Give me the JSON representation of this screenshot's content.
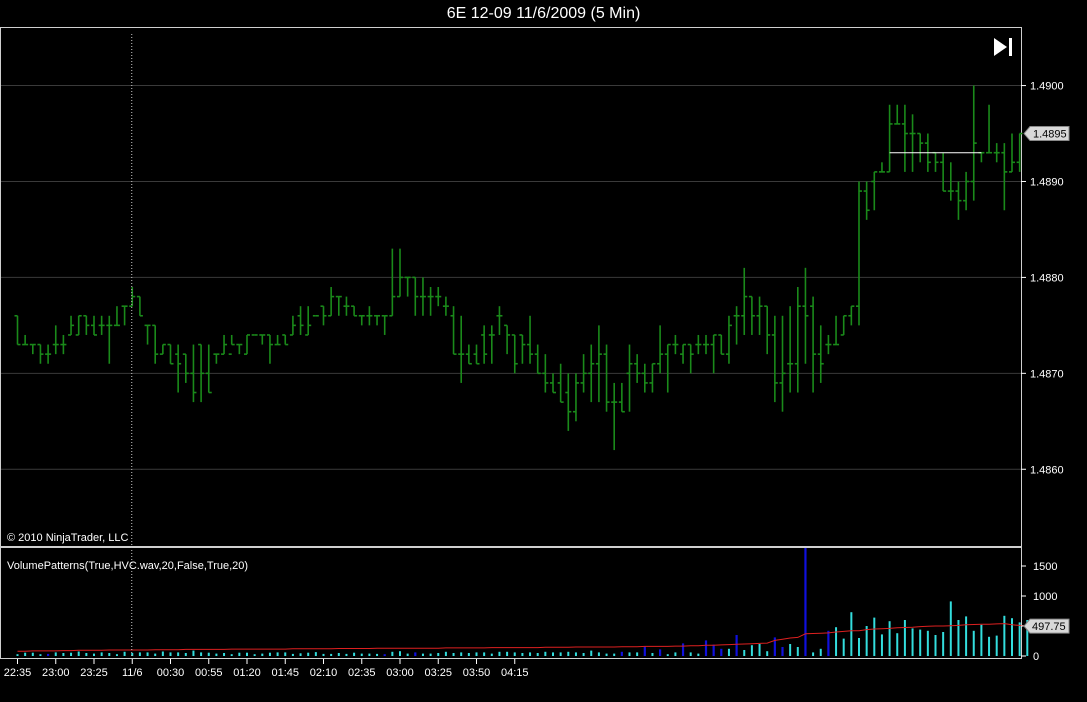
{
  "window": {
    "title": "6E 12-09  11/6/2009 (5 Min)"
  },
  "copyright": "© 2010 NinjaTrader, LLC",
  "indicator_label": "VolumePatterns(True,HVC.wav,20,False,True,20)",
  "icons": {
    "go_to_end": "skip-to-end-icon"
  },
  "colors": {
    "bars": "#1a8a1a",
    "volume_normal": "#33dddd",
    "volume_high": "#1010dd",
    "volume_ma": "#dd2020",
    "grid": "#3a3a3a",
    "last_price_line": "#ffffff"
  },
  "chart_data": [
    {
      "type": "ohlc",
      "price_ylim": [
        1.4852,
        1.4906
      ],
      "y_ticks": [
        "1.4860",
        "1.4870",
        "1.4880",
        "1.4890",
        "1.4900"
      ],
      "last_price_marker": "1.4895",
      "x_tick_labels": [
        "22:35",
        "23:00",
        "23:25",
        "11/6",
        "00:30",
        "00:55",
        "01:20",
        "01:45",
        "02:10",
        "02:35",
        "03:00",
        "03:25",
        "03:50",
        "04:15"
      ],
      "session_break_label": "11/6",
      "bars": [
        [
          1.4876,
          1.4876,
          1.4873,
          1.4873
        ],
        [
          1.4873,
          1.4874,
          1.4873,
          1.4873
        ],
        [
          1.4873,
          1.4873,
          1.4872,
          1.4873
        ],
        [
          1.4873,
          1.4873,
          1.4871,
          1.4872
        ],
        [
          1.4872,
          1.4873,
          1.4871,
          1.4872
        ],
        [
          1.4873,
          1.4875,
          1.4872,
          1.4873
        ],
        [
          1.4873,
          1.4874,
          1.4872,
          1.4873
        ],
        [
          1.4874,
          1.4876,
          1.4874,
          1.4875
        ],
        [
          1.4874,
          1.4876,
          1.4874,
          1.4876
        ],
        [
          1.4876,
          1.4876,
          1.4874,
          1.4875
        ],
        [
          1.4875,
          1.4876,
          1.4874,
          1.4874
        ],
        [
          1.4875,
          1.4876,
          1.4874,
          1.4875
        ],
        [
          1.4875,
          1.4876,
          1.4871,
          1.4875
        ],
        [
          1.4875,
          1.4877,
          1.4875,
          1.4875
        ],
        [
          1.4877,
          1.4877,
          1.4875,
          1.4877
        ],
        [
          1.4877,
          1.4879,
          1.4877,
          1.4878
        ],
        [
          1.4878,
          1.4878,
          1.4876,
          1.4876
        ],
        [
          1.4875,
          1.4875,
          1.4873,
          1.4875
        ],
        [
          1.4875,
          1.4875,
          1.4871,
          1.4872
        ],
        [
          1.4872,
          1.4873,
          1.4872,
          1.4873
        ],
        [
          1.4873,
          1.4873,
          1.4871,
          1.4871
        ],
        [
          1.4872,
          1.4873,
          1.4868,
          1.4871
        ],
        [
          1.4872,
          1.4872,
          1.4869,
          1.487
        ],
        [
          1.487,
          1.4873,
          1.4867,
          1.4868
        ],
        [
          1.4873,
          1.4873,
          1.4867,
          1.487
        ],
        [
          1.487,
          1.4873,
          1.4868,
          1.4868
        ],
        [
          1.4872,
          1.4872,
          1.4871,
          1.4872
        ],
        [
          1.4872,
          1.4874,
          1.4872,
          1.4873
        ],
        [
          1.4872,
          1.4874,
          1.4873,
          1.4873
        ],
        [
          1.4873,
          1.4873,
          1.4872,
          1.4873
        ],
        [
          1.4872,
          1.4874,
          1.4872,
          1.4874
        ],
        [
          1.4874,
          1.4874,
          1.4874,
          1.4874
        ],
        [
          1.4874,
          1.4874,
          1.4873,
          1.4874
        ],
        [
          1.4874,
          1.4874,
          1.4871,
          1.4873
        ],
        [
          1.4873,
          1.4874,
          1.4873,
          1.4873
        ],
        [
          1.4874,
          1.4874,
          1.4873,
          1.4873
        ],
        [
          1.4874,
          1.4876,
          1.4874,
          1.4875
        ],
        [
          1.4876,
          1.4877,
          1.4874,
          1.4875
        ],
        [
          1.4874,
          1.4877,
          1.4874,
          1.4875
        ],
        [
          1.4876,
          1.4876,
          1.4876,
          1.4876
        ],
        [
          1.4877,
          1.4877,
          1.4875,
          1.4876
        ],
        [
          1.4876,
          1.4879,
          1.4876,
          1.4878
        ],
        [
          1.4878,
          1.4878,
          1.4876,
          1.4878
        ],
        [
          1.4877,
          1.4878,
          1.4876,
          1.4877
        ],
        [
          1.4877,
          1.4877,
          1.4876,
          1.4876
        ],
        [
          1.4876,
          1.4876,
          1.4875,
          1.4876
        ],
        [
          1.4876,
          1.4877,
          1.4875,
          1.4876
        ],
        [
          1.4876,
          1.4876,
          1.4875,
          1.4876
        ],
        [
          1.4876,
          1.4876,
          1.4874,
          1.4876
        ],
        [
          1.4876,
          1.4883,
          1.4876,
          1.4878
        ],
        [
          1.4878,
          1.4883,
          1.4878,
          1.488
        ],
        [
          1.488,
          1.488,
          1.4878,
          1.488
        ],
        [
          1.488,
          1.488,
          1.4876,
          1.4878
        ],
        [
          1.4878,
          1.488,
          1.4876,
          1.4878
        ],
        [
          1.4878,
          1.4879,
          1.4876,
          1.4878
        ],
        [
          1.4878,
          1.4879,
          1.4877,
          1.4878
        ],
        [
          1.4877,
          1.4878,
          1.4876,
          1.4877
        ],
        [
          1.4876,
          1.4877,
          1.4872,
          1.4872
        ],
        [
          1.4872,
          1.4876,
          1.4869,
          1.4872
        ],
        [
          1.4872,
          1.4873,
          1.4871,
          1.4871
        ],
        [
          1.4872,
          1.4873,
          1.4871,
          1.4871
        ],
        [
          1.4874,
          1.4875,
          1.4871,
          1.4872
        ],
        [
          1.4874,
          1.4875,
          1.4871,
          1.4874
        ],
        [
          1.4876,
          1.4877,
          1.4874,
          1.4876
        ],
        [
          1.4875,
          1.4875,
          1.4872,
          1.4874
        ],
        [
          1.4874,
          1.4874,
          1.487,
          1.4871
        ],
        [
          1.4874,
          1.4874,
          1.4871,
          1.4873
        ],
        [
          1.4873,
          1.4876,
          1.4871,
          1.4872
        ],
        [
          1.4872,
          1.4873,
          1.487,
          1.487
        ],
        [
          1.487,
          1.4872,
          1.4868,
          1.4869
        ],
        [
          1.4869,
          1.487,
          1.4868,
          1.4868
        ],
        [
          1.4869,
          1.4871,
          1.4867,
          1.4867
        ],
        [
          1.4868,
          1.487,
          1.4864,
          1.4866
        ],
        [
          1.4866,
          1.487,
          1.4865,
          1.4869
        ],
        [
          1.4869,
          1.4872,
          1.4868,
          1.487
        ],
        [
          1.487,
          1.4873,
          1.4867,
          1.4871
        ],
        [
          1.4871,
          1.4875,
          1.4867,
          1.4872
        ],
        [
          1.4872,
          1.4873,
          1.4866,
          1.4867
        ],
        [
          1.4867,
          1.4869,
          1.4862,
          1.4867
        ],
        [
          1.4867,
          1.4869,
          1.4866,
          1.4866
        ],
        [
          1.487,
          1.4873,
          1.4866,
          1.4871
        ],
        [
          1.4871,
          1.4872,
          1.4869,
          1.487
        ],
        [
          1.487,
          1.4871,
          1.4868,
          1.4869
        ],
        [
          1.4869,
          1.4871,
          1.4868,
          1.4871
        ],
        [
          1.4871,
          1.4875,
          1.487,
          1.4872
        ],
        [
          1.4872,
          1.4873,
          1.4868,
          1.4873
        ],
        [
          1.4873,
          1.4874,
          1.4872,
          1.4873
        ],
        [
          1.4872,
          1.4873,
          1.4871,
          1.4873
        ],
        [
          1.4873,
          1.4873,
          1.487,
          1.4872
        ],
        [
          1.4873,
          1.4874,
          1.4872,
          1.4873
        ],
        [
          1.4873,
          1.4874,
          1.4872,
          1.4873
        ],
        [
          1.4873,
          1.4874,
          1.487,
          1.4874
        ],
        [
          1.4874,
          1.4874,
          1.4872,
          1.4872
        ],
        [
          1.4872,
          1.4876,
          1.4871,
          1.4875
        ],
        [
          1.4876,
          1.4877,
          1.4873,
          1.4876
        ],
        [
          1.4876,
          1.4881,
          1.4874,
          1.4878
        ],
        [
          1.4878,
          1.4878,
          1.4874,
          1.4876
        ],
        [
          1.4876,
          1.4878,
          1.4874,
          1.4877
        ],
        [
          1.4877,
          1.4877,
          1.4872,
          1.4874
        ],
        [
          1.4874,
          1.4876,
          1.4867,
          1.4869
        ],
        [
          1.4869,
          1.4876,
          1.4866,
          1.487
        ],
        [
          1.4871,
          1.4877,
          1.4868,
          1.4871
        ],
        [
          1.4871,
          1.4879,
          1.4868,
          1.4877
        ],
        [
          1.4877,
          1.4881,
          1.4871,
          1.4876
        ],
        [
          1.4877,
          1.4878,
          1.4868,
          1.4872
        ],
        [
          1.4872,
          1.4875,
          1.4869,
          1.4871
        ],
        [
          1.4873,
          1.4874,
          1.4872,
          1.4873
        ],
        [
          1.4873,
          1.4876,
          1.4873,
          1.4873
        ],
        [
          1.4874,
          1.4876,
          1.4874,
          1.4876
        ],
        [
          1.4876,
          1.4877,
          1.4875,
          1.4877
        ],
        [
          1.4877,
          1.489,
          1.4875,
          1.4889
        ],
        [
          1.4889,
          1.489,
          1.4886,
          1.4887
        ],
        [
          1.489,
          1.4891,
          1.4887,
          1.4891
        ],
        [
          1.4891,
          1.4892,
          1.4891,
          1.4891
        ],
        [
          1.4891,
          1.4898,
          1.4891,
          1.4896
        ],
        [
          1.4896,
          1.4898,
          1.4896,
          1.4896
        ],
        [
          1.4896,
          1.4898,
          1.4891,
          1.4895
        ],
        [
          1.4895,
          1.4897,
          1.4891,
          1.4895
        ],
        [
          1.4895,
          1.4895,
          1.4892,
          1.4894
        ],
        [
          1.4894,
          1.4895,
          1.4891,
          1.4892
        ],
        [
          1.4893,
          1.4893,
          1.4891,
          1.4892
        ],
        [
          1.4892,
          1.4893,
          1.4889,
          1.4889
        ],
        [
          1.4889,
          1.4892,
          1.4888,
          1.4889
        ],
        [
          1.4889,
          1.489,
          1.4886,
          1.4888
        ],
        [
          1.4888,
          1.4891,
          1.4887,
          1.489
        ],
        [
          1.489,
          1.49,
          1.4888,
          1.4894
        ],
        [
          1.4893,
          1.4893,
          1.4892,
          1.4893
        ],
        [
          1.4893,
          1.4898,
          1.4893,
          1.4893
        ],
        [
          1.4893,
          1.4894,
          1.4892,
          1.4893
        ],
        [
          1.4893,
          1.4894,
          1.4887,
          1.4891
        ],
        [
          1.4891,
          1.4895,
          1.4891,
          1.4892
        ],
        [
          1.4892,
          1.4895,
          1.4891,
          1.4895
        ]
      ],
      "last_price_line": {
        "from_bar": 114,
        "to_bar": 126,
        "price": 1.4893
      }
    },
    {
      "type": "bar",
      "name": "VolumePatterns",
      "volume_ylim": [
        0,
        1800
      ],
      "y_ticks": [
        "0",
        "500",
        "1000",
        "1500"
      ],
      "last_value_marker": "497.75",
      "volume": [
        30,
        55,
        55,
        30,
        35,
        60,
        50,
        55,
        75,
        50,
        40,
        60,
        50,
        30,
        70,
        50,
        60,
        60,
        40,
        75,
        60,
        60,
        50,
        90,
        60,
        55,
        40,
        50,
        30,
        55,
        55,
        30,
        40,
        55,
        60,
        60,
        35,
        45,
        55,
        65,
        35,
        35,
        50,
        35,
        55,
        40,
        40,
        35,
        30,
        70,
        80,
        40,
        60,
        40,
        40,
        50,
        70,
        50,
        60,
        50,
        60,
        60,
        40,
        70,
        70,
        60,
        50,
        60,
        50,
        70,
        60,
        60,
        70,
        60,
        50,
        90,
        60,
        40,
        40,
        70,
        60,
        60,
        160,
        50,
        110,
        30,
        60,
        210,
        60,
        40,
        260,
        190,
        120,
        120,
        350,
        100,
        180,
        200,
        80,
        310,
        150,
        200,
        150,
        1800,
        60,
        120,
        420,
        480,
        290,
        730,
        300,
        500,
        640,
        360,
        580,
        380,
        600,
        460,
        440,
        420,
        350,
        400,
        910,
        600,
        660,
        420,
        520,
        320,
        340,
        670,
        630,
        560,
        600
      ],
      "high_volume_bars": [
        4,
        48,
        52,
        79,
        82,
        84,
        87,
        90,
        91,
        92,
        94,
        99,
        100,
        103,
        106
      ],
      "moving_average": [
        80,
        80,
        85,
        85,
        85,
        85,
        90,
        90,
        95,
        95,
        95,
        95,
        100,
        100,
        100,
        100,
        100,
        100,
        105,
        105,
        105,
        105,
        110,
        110,
        110,
        110,
        110,
        110,
        115,
        115,
        115,
        115,
        115,
        115,
        115,
        115,
        120,
        120,
        120,
        120,
        120,
        120,
        125,
        125,
        125,
        125,
        125,
        130,
        130,
        130,
        130,
        130,
        130,
        130,
        130,
        130,
        135,
        135,
        135,
        135,
        135,
        135,
        140,
        140,
        140,
        140,
        140,
        140,
        140,
        145,
        145,
        145,
        145,
        150,
        150,
        150,
        150,
        150,
        150,
        155,
        155,
        155,
        160,
        160,
        160,
        160,
        165,
        165,
        170,
        170,
        180,
        180,
        185,
        190,
        195,
        200,
        205,
        210,
        215,
        260,
        280,
        300,
        310,
        370,
        375,
        380,
        385,
        400,
        410,
        420,
        420,
        440,
        450,
        455,
        460,
        470,
        475,
        480,
        490,
        495,
        500,
        500,
        505,
        510,
        520,
        525,
        530,
        530,
        535,
        540,
        520,
        510,
        497.75
      ]
    }
  ]
}
